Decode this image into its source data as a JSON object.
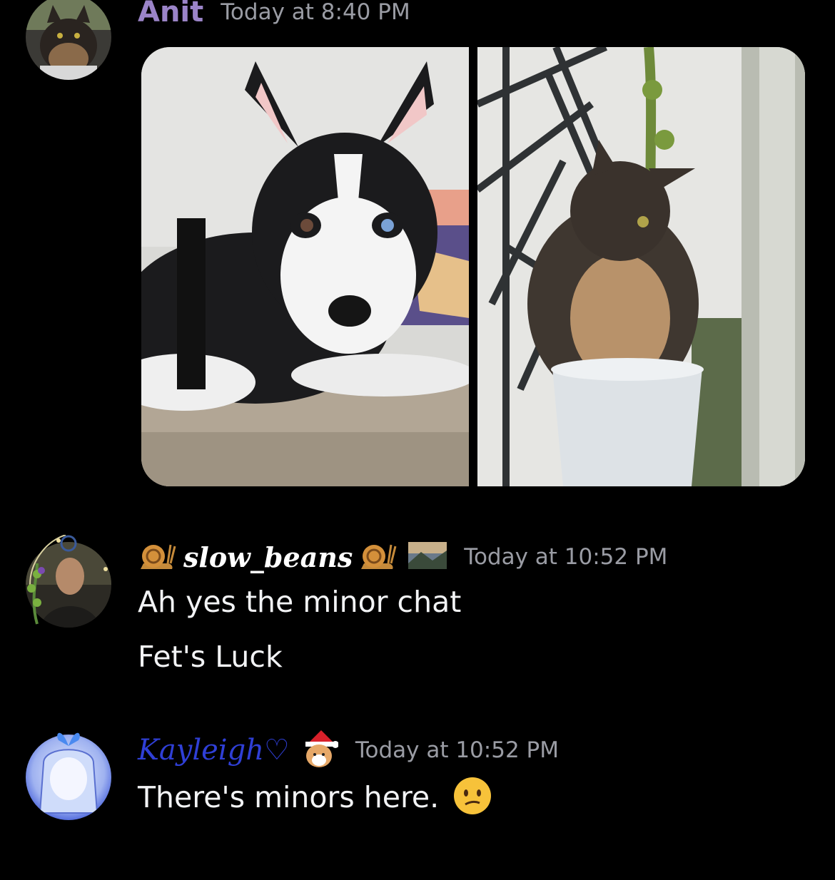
{
  "messages": [
    {
      "author": "Anit",
      "author_color": "#9b84c8",
      "timestamp": "Today at 8:40 PM",
      "attachments": [
        {
          "icon": "husky-puppy-photo"
        },
        {
          "icon": "tortoiseshell-cat-in-pot-photo"
        }
      ]
    },
    {
      "author": "slow_beans",
      "author_color": "#ffffff",
      "author_decorations": [
        "snail-icon",
        "snail-icon",
        "landscape-badge-icon"
      ],
      "timestamp": "Today at 10:52 PM",
      "lines": [
        "Ah yes the minor chat",
        "Fet's Luck"
      ]
    },
    {
      "author": "Kayleigh♡",
      "author_color": "#2f3fd6",
      "author_decorations": [
        "santa-cat-icon"
      ],
      "timestamp": "Today at 10:52 PM",
      "lines": [
        "There's minors here."
      ],
      "trailing_emoji": "confused-face-icon"
    }
  ]
}
